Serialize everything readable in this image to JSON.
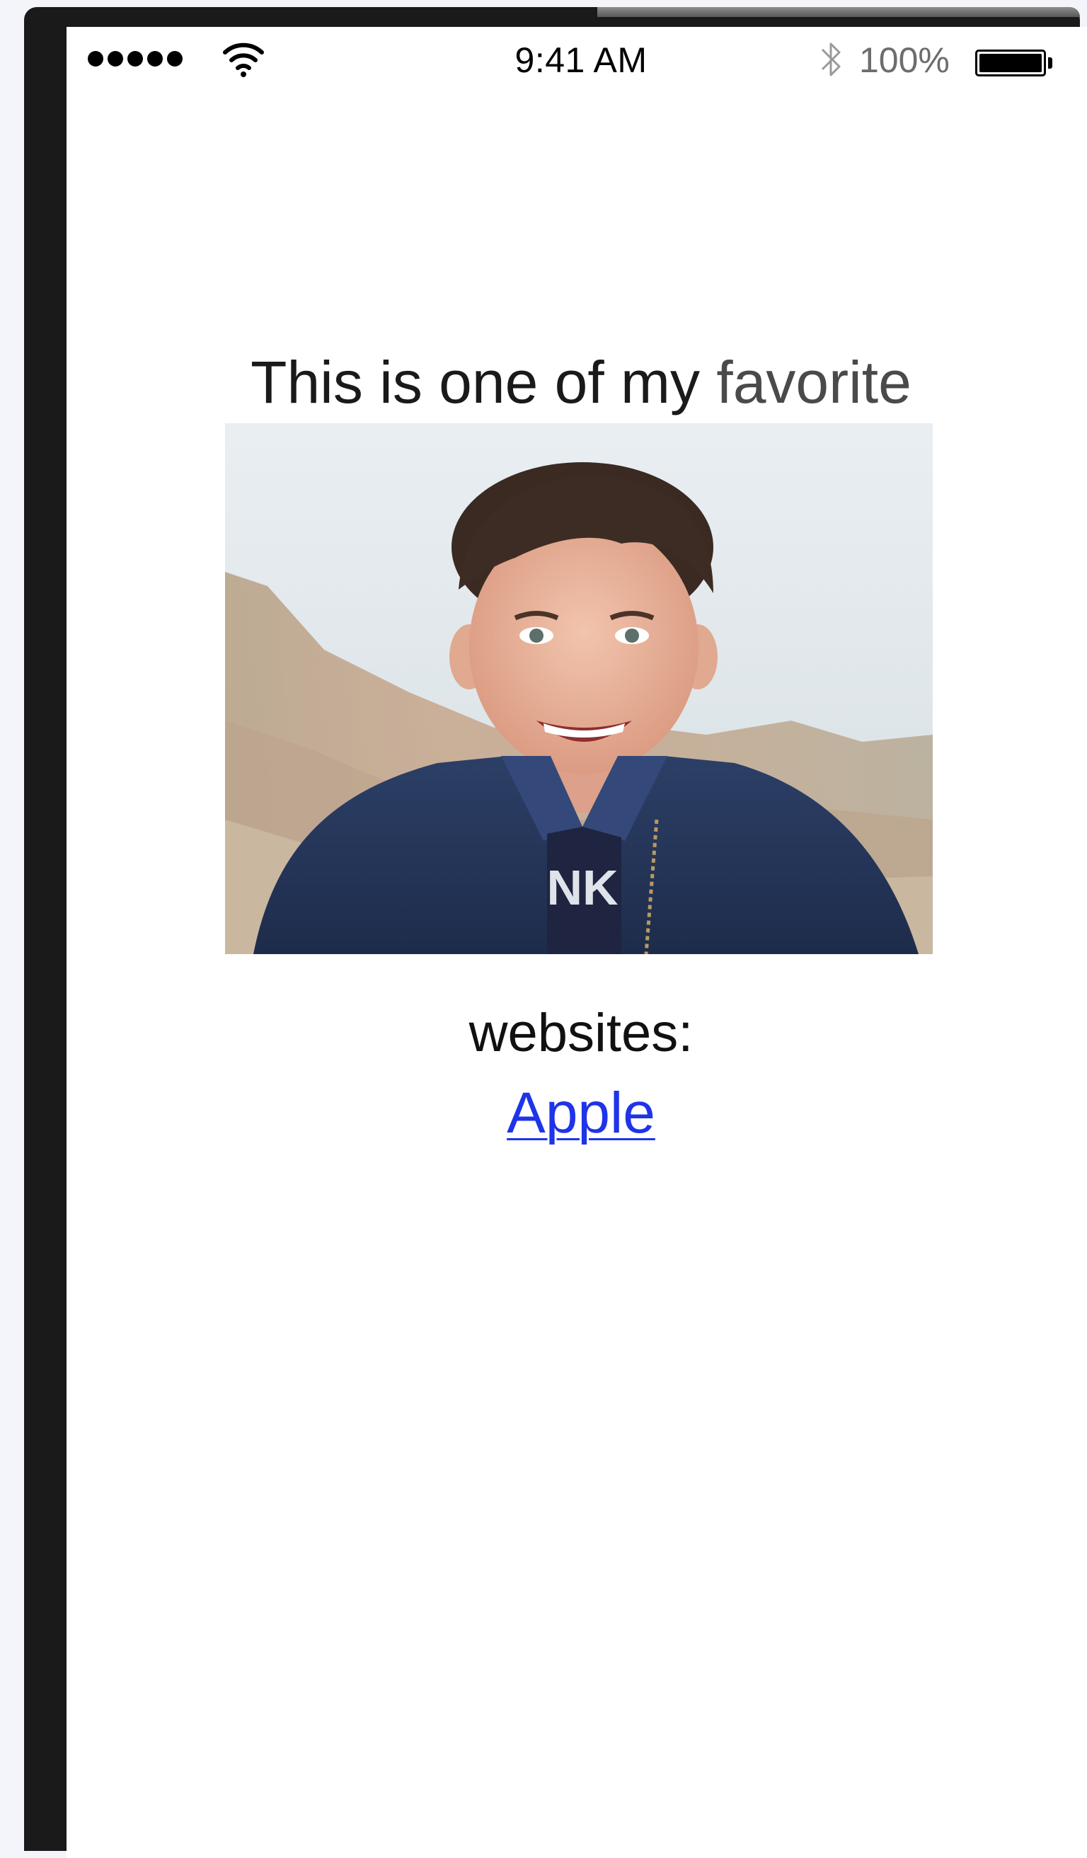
{
  "status_bar": {
    "time": "9:41 AM",
    "battery_percent": "100%",
    "signal_bars": 5,
    "battery_level": 1.0,
    "icons": [
      "signal-dots-icon",
      "wifi-icon",
      "bluetooth-icon",
      "battery-icon"
    ]
  },
  "content": {
    "headline_part1": "This is one of my",
    "headline_part2": "favorite",
    "websites_label": "websites:",
    "link_text": "Apple",
    "image_description": "photo"
  },
  "colors": {
    "link": "#1f34e8",
    "text": "#1a1a1a",
    "battery_text": "#6d6d6d"
  }
}
